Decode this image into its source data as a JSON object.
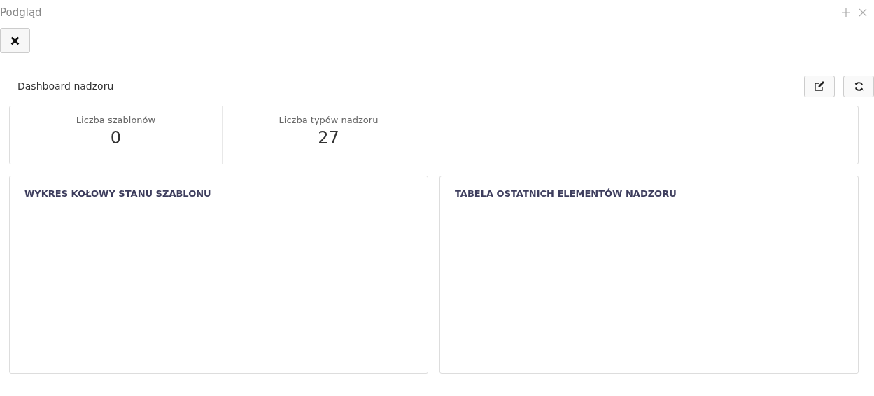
{
  "window": {
    "title": "Podgląd"
  },
  "dashboard": {
    "title": "Dashboard nadzoru"
  },
  "stats": [
    {
      "label": "Liczba szablonów",
      "value": "0"
    },
    {
      "label": "Liczba typów nadzoru",
      "value": "27"
    }
  ],
  "panels": [
    {
      "title": "WYKRES KOŁOWY STANU SZABLONU"
    },
    {
      "title": "TABELA OSTATNICH ELEMENTÓW NADZORU"
    }
  ]
}
